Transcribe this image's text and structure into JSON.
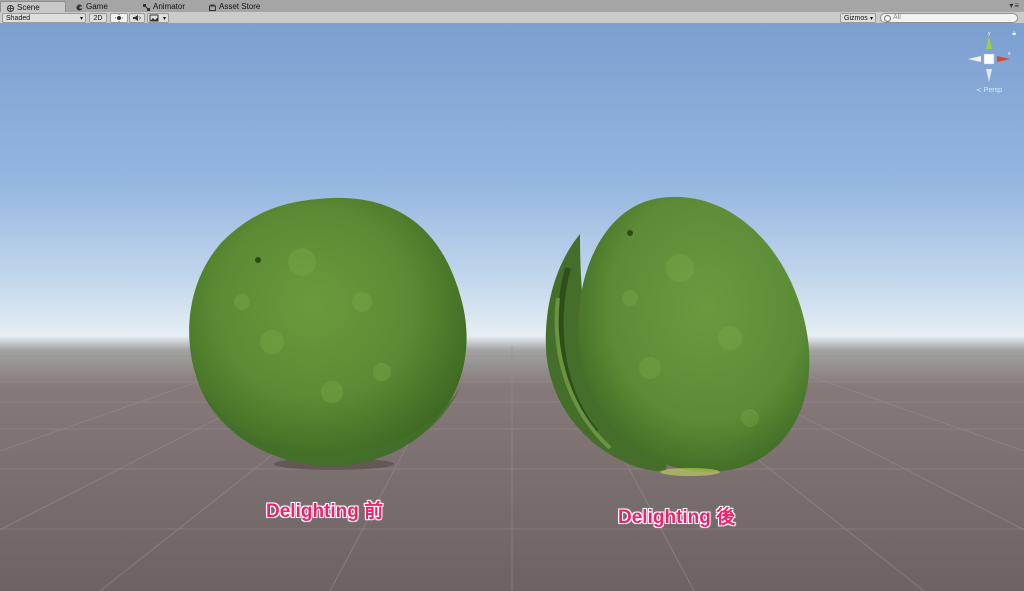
{
  "tabs": [
    {
      "label": "Scene",
      "icon": "scene-icon",
      "active": true
    },
    {
      "label": "Game",
      "icon": "game-icon",
      "active": false
    },
    {
      "label": "Animator",
      "icon": "animator-icon",
      "active": false
    },
    {
      "label": "Asset Store",
      "icon": "asset-store-icon",
      "active": false
    }
  ],
  "toolbar": {
    "shading_mode": "Shaded",
    "mode_2d": "2D",
    "gizmos": "Gizmos",
    "search_placeholder": "All"
  },
  "viewport": {
    "projection_label": "Persp",
    "label_before": "Delighting 前",
    "label_after": "Delighting 後",
    "label_color": "#f0206e"
  }
}
